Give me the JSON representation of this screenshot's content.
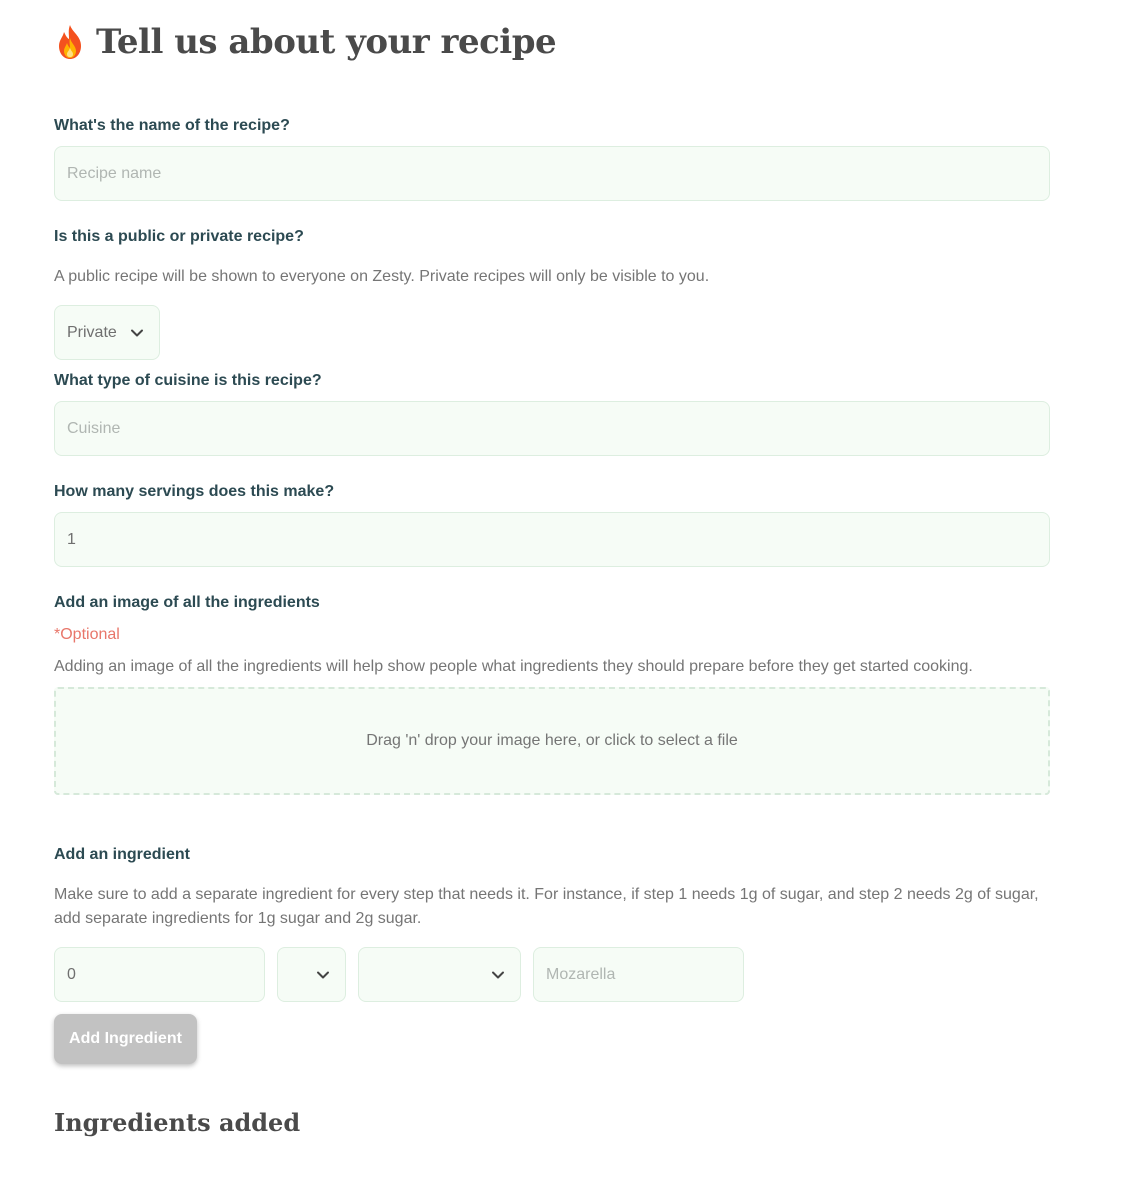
{
  "header": {
    "title": "Tell us about your recipe",
    "icon": "flame-icon"
  },
  "recipe_name": {
    "label": "What's the name of the recipe?",
    "placeholder": "Recipe name",
    "value": ""
  },
  "visibility": {
    "label": "Is this a public or private recipe?",
    "help": "A public recipe will be shown to everyone on Zesty. Private recipes will only be visible to you.",
    "selected": "Private",
    "icon": "chevron-down-icon"
  },
  "cuisine": {
    "label": "What type of cuisine is this recipe?",
    "placeholder": "Cuisine",
    "value": ""
  },
  "servings": {
    "label": "How many servings does this make?",
    "value": "1"
  },
  "ingredients_image": {
    "label": "Add an image of all the ingredients",
    "optional": "*Optional",
    "help": "Adding an image of all the ingredients will help show people what ingredients they should prepare before they get started cooking.",
    "dropzone_text": "Drag 'n' drop your image here, or click to select a file"
  },
  "add_ingredient": {
    "label": "Add an ingredient",
    "help": "Make sure to add a separate ingredient for every step that needs it. For instance, if step 1 needs 1g of sugar, and step 2 needs 2g of sugar, add separate ingredients for 1g sugar and 2g sugar.",
    "quantity_value": "0",
    "unit_selected": "",
    "step_selected": "",
    "name_placeholder": "Mozarella",
    "button_label": "Add Ingredient"
  },
  "ingredients_added": {
    "title": "Ingredients added"
  },
  "colors": {
    "accent_label": "#2c4a52",
    "input_bg": "#f6fcf6",
    "input_border": "#ddeee0",
    "optional": "#e8766a",
    "button_disabled": "#c2c2c2"
  }
}
